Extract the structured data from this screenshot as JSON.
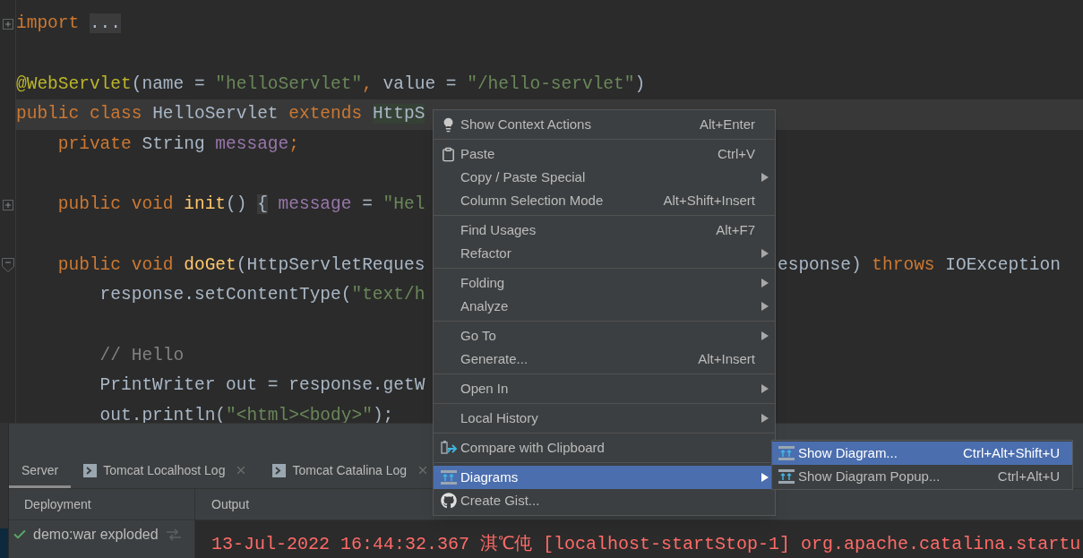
{
  "editor": {
    "lines": [
      {
        "collapsed": true,
        "left": [
          {
            "kind": "keyword",
            "text": "import "
          },
          {
            "kind": "folded",
            "text": "..."
          }
        ]
      },
      {
        "blank_before": true,
        "left": [
          {
            "kind": "annotation",
            "text": "@WebServlet"
          },
          {
            "kind": "plain",
            "text": "(name = "
          },
          {
            "kind": "string",
            "text": "\"helloServlet\""
          },
          {
            "kind": "keyword",
            "text": ","
          },
          {
            "kind": "plain",
            "text": " value = "
          },
          {
            "kind": "string",
            "text": "\"/hello-servlet\""
          },
          {
            "kind": "plain",
            "text": ")"
          }
        ]
      },
      {
        "current": true,
        "left": [
          {
            "kind": "keyword",
            "text": "public class "
          },
          {
            "kind": "plain",
            "text": "HelloServlet "
          },
          {
            "kind": "keyword",
            "text": "extends "
          },
          {
            "kind": "usage",
            "text": "HttpS"
          }
        ]
      },
      {
        "left": [
          {
            "kind": "keyword",
            "text": "    private "
          },
          {
            "kind": "plain",
            "text": "String "
          },
          {
            "kind": "field",
            "text": "message"
          },
          {
            "kind": "keyword",
            "text": ";"
          }
        ]
      },
      {
        "blank_before": true,
        "collapsed": true,
        "left": [
          {
            "kind": "keyword",
            "text": "    public void "
          },
          {
            "kind": "method",
            "text": "init"
          },
          {
            "kind": "plain",
            "text": "() "
          },
          {
            "kind": "folded",
            "text": "{"
          },
          {
            "kind": "field",
            "text": " message"
          },
          {
            "kind": "plain",
            "text": " = "
          },
          {
            "kind": "string",
            "text": "\"Hel"
          }
        ]
      },
      {
        "blank_before": true,
        "collapsed": false,
        "left": [
          {
            "kind": "keyword",
            "text": "    public void "
          },
          {
            "kind": "method",
            "text": "doGet"
          },
          {
            "kind": "plain",
            "text": "(HttpServletReques"
          }
        ],
        "right": [
          {
            "kind": "plain",
            "text": "esponse) "
          },
          {
            "kind": "keyword",
            "text": "throws "
          },
          {
            "kind": "plain",
            "text": "IOException"
          }
        ]
      },
      {
        "left": [
          {
            "kind": "plain",
            "text": "        response.setContentType("
          },
          {
            "kind": "string",
            "text": "\"text/h"
          }
        ]
      },
      {
        "blank_before": true,
        "left": [
          {
            "kind": "comment",
            "text": "        // Hello"
          }
        ]
      },
      {
        "left": [
          {
            "kind": "plain",
            "text": "        PrintWriter out = response.getW"
          }
        ]
      },
      {
        "left": [
          {
            "kind": "plain",
            "text": "        out.println("
          },
          {
            "kind": "string",
            "text": "\"<html><body>\""
          },
          {
            "kind": "plain",
            "text": ");"
          }
        ]
      }
    ]
  },
  "context_menu": {
    "sections": [
      {
        "items": [
          {
            "label": "Show Context Actions",
            "shortcut": "Alt+Enter",
            "selected": false
          }
        ]
      },
      {
        "items": [
          {
            "label": "Paste",
            "shortcut": "Ctrl+V",
            "selected": false
          },
          {
            "label": "Copy / Paste Special",
            "submenu": true,
            "selected": false
          },
          {
            "label": "Column Selection Mode",
            "shortcut": "Alt+Shift+Insert",
            "selected": false
          }
        ]
      },
      {
        "items": [
          {
            "label": "Find Usages",
            "shortcut": "Alt+F7",
            "selected": false
          },
          {
            "label": "Refactor",
            "submenu": true,
            "selected": false
          }
        ]
      },
      {
        "items": [
          {
            "label": "Folding",
            "submenu": true,
            "selected": false
          },
          {
            "label": "Analyze",
            "submenu": true,
            "selected": false
          }
        ]
      },
      {
        "items": [
          {
            "label": "Go To",
            "submenu": true,
            "selected": false
          },
          {
            "label": "Generate...",
            "shortcut": "Alt+Insert",
            "selected": false
          }
        ]
      },
      {
        "items": [
          {
            "label": "Open In",
            "submenu": true,
            "selected": false
          }
        ]
      },
      {
        "items": [
          {
            "label": "Local History",
            "submenu": true,
            "selected": false
          }
        ]
      },
      {
        "items": [
          {
            "label": "Compare with Clipboard",
            "selected": false
          }
        ]
      },
      {
        "items": [
          {
            "label": "Diagrams",
            "submenu": true,
            "selected": true
          },
          {
            "label": "Create Gist...",
            "selected": false
          }
        ]
      }
    ]
  },
  "submenu": {
    "items": [
      {
        "label": "Show Diagram...",
        "shortcut": "Ctrl+Alt+Shift+U",
        "selected": true
      },
      {
        "label": "Show Diagram Popup...",
        "shortcut": "Ctrl+Alt+U",
        "selected": false
      }
    ]
  },
  "tool_window": {
    "tabs": [
      {
        "label": "Server",
        "selected": true
      },
      {
        "label": "Tomcat Localhost Log",
        "selected": false,
        "closable": true
      },
      {
        "label": "Tomcat Catalina Log",
        "selected": false,
        "closable": true
      }
    ],
    "columns": [
      "Deployment",
      "Output"
    ],
    "deployments": [
      {
        "name": "demo:war exploded",
        "deployed": true
      }
    ],
    "output_lines": [
      "13-Jul-2022 16:44:32.367 淇℃伅 [localhost-startStop-1] org.apache.catalina.startu"
    ]
  }
}
